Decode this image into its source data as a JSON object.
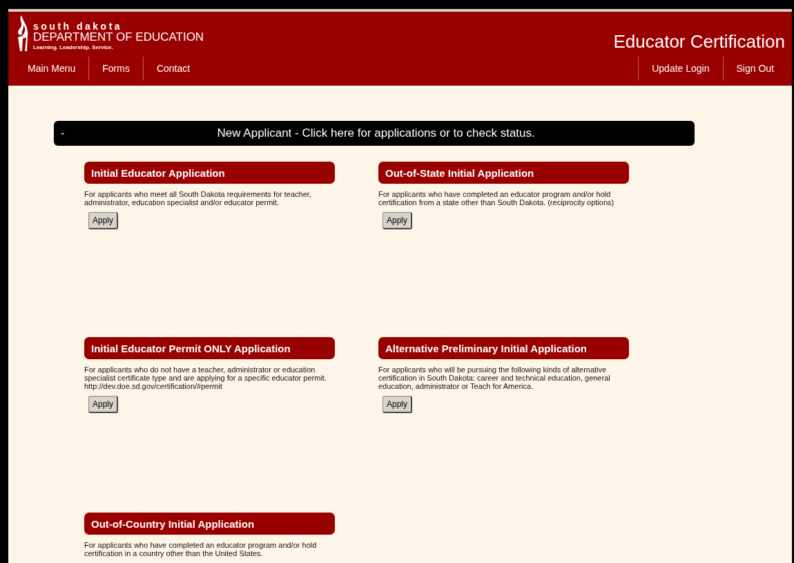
{
  "header": {
    "logo_line_1": "south dakota",
    "logo_line_2": "DEPARTMENT OF EDUCATION",
    "logo_tagline": "Learning. Leadership. Service.",
    "title": "Educator Certification"
  },
  "nav_left": [
    "Main Menu",
    "Forms",
    "Contact"
  ],
  "nav_right": [
    "Update Login",
    "Sign Out"
  ],
  "banner": {
    "toggle": "-",
    "text": "New Applicant - Click here for applications or to check status."
  },
  "applications": [
    {
      "title": "Initial Educator Application",
      "description": "For applicants who meet all South Dakota requirements for teacher, administrator, education specialist and/or educator permit.",
      "button": "Apply"
    },
    {
      "title": "Out-of-State Initial Application",
      "description": "For applicants who have completed an educator program and/or hold certification from a state other than South Dakota. (reciprocity options)",
      "button": "Apply"
    },
    {
      "title": "Initial Educator Permit ONLY Application",
      "description": "For applicants who do not have a teacher, administrator or education specialist certificate type and are applying for a specific educator permit. http://dev.doe.sd.gov/certification/#permit",
      "button": "Apply"
    },
    {
      "title": "Alternative Preliminary Initial Application",
      "description": "For applicants who will be pursuing the following kinds of alternative certification in South Dakota: career and technical education, general education, administrator or Teach for America.",
      "button": "Apply"
    },
    {
      "title": "Out-of-Country Initial Application",
      "description": "For applicants who have completed an educator program and/or hold certification in a country other than the United States."
    }
  ]
}
